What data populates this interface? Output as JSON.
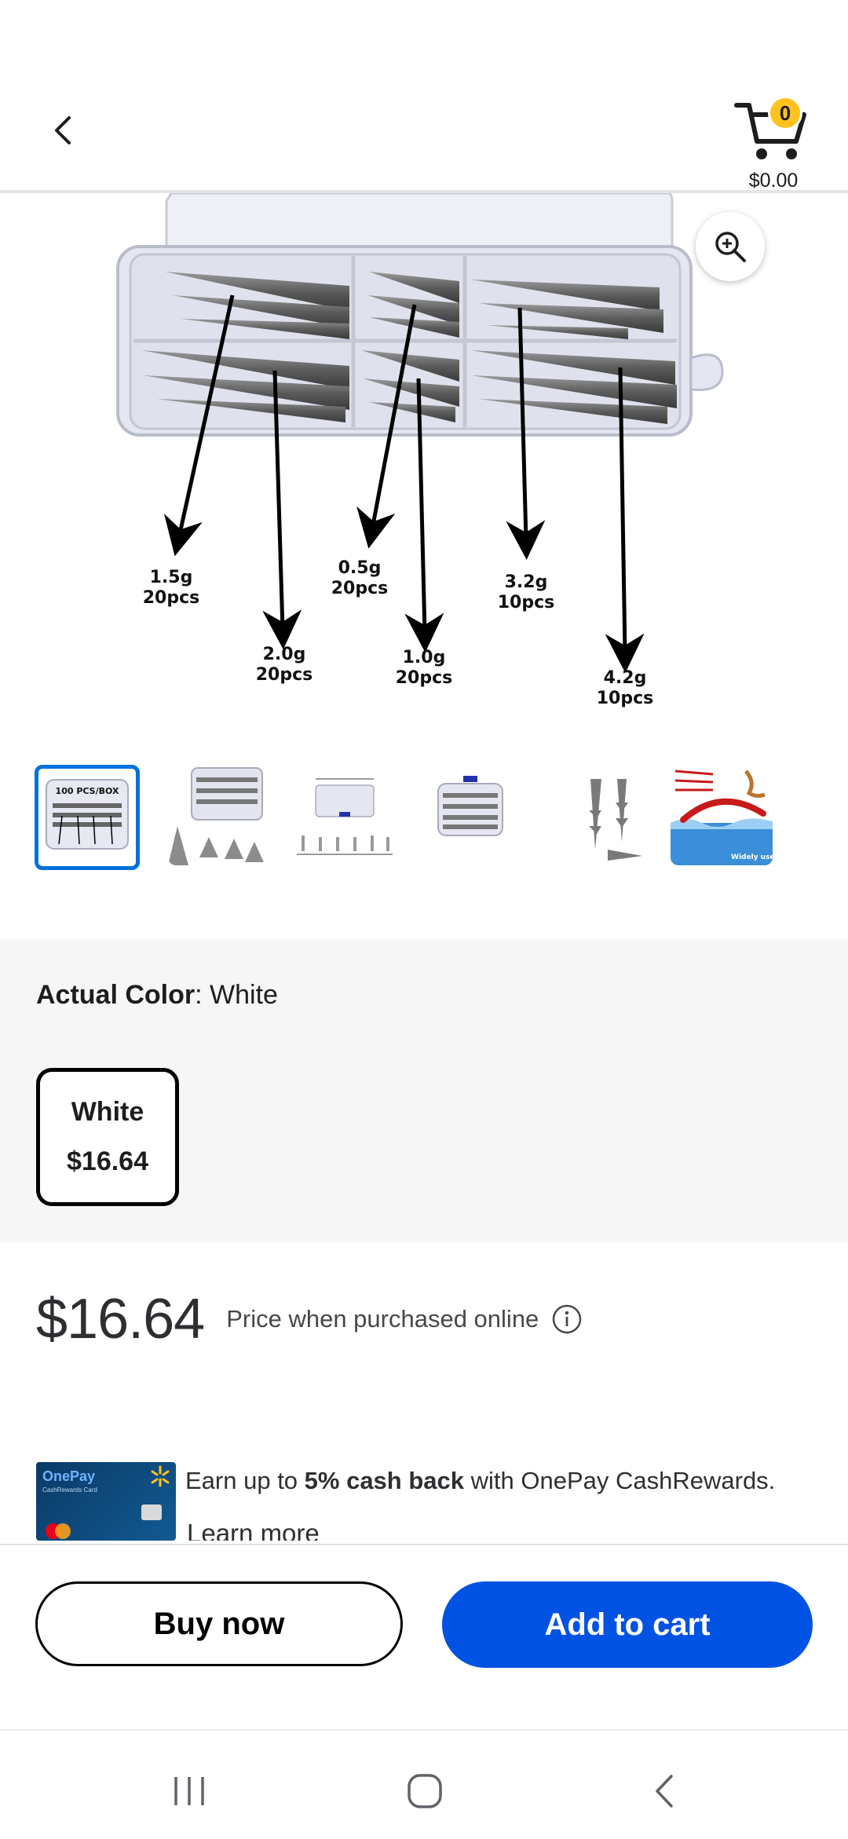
{
  "header": {
    "cart_count": "0",
    "cart_total": "$0.00"
  },
  "product": {
    "image_labels": [
      {
        "weight": "1.5g",
        "count": "20pcs"
      },
      {
        "weight": "2.0g",
        "count": "20pcs"
      },
      {
        "weight": "0.5g",
        "count": "20pcs"
      },
      {
        "weight": "1.0g",
        "count": "20pcs"
      },
      {
        "weight": "3.2g",
        "count": "10pcs"
      },
      {
        "weight": "4.2g",
        "count": "10pcs"
      }
    ],
    "thumbnails": [
      {
        "caption": "100 PCS/BOX"
      },
      {
        "caption": ""
      },
      {
        "caption": ""
      },
      {
        "caption": ""
      },
      {
        "caption": ""
      },
      {
        "caption": "Widely used"
      }
    ],
    "selected_thumbnail_index": 0
  },
  "variant": {
    "label": "Actual Color",
    "separator": ":",
    "value": "White",
    "options": [
      {
        "name": "White",
        "price": "$16.64",
        "selected": true
      }
    ]
  },
  "pricing": {
    "price": "$16.64",
    "note": "Price when purchased online"
  },
  "promo": {
    "card_brand": "OnePay",
    "card_subtitle": "CashRewards Card",
    "text_pre": "Earn up to ",
    "text_bold": "5% cash back",
    "text_post": " with OnePay CashRewards.",
    "link": "Learn more"
  },
  "actions": {
    "buy_now": "Buy now",
    "add_to_cart": "Add to cart"
  },
  "colors": {
    "primary_blue": "#0053e2",
    "selected_border": "#0071dc",
    "badge_yellow": "#ffc220"
  },
  "icons": {
    "back": "chevron-left-icon",
    "cart": "cart-icon",
    "zoom": "zoom-in-icon",
    "info": "info-icon",
    "nav_recent": "recent-apps-icon",
    "nav_home": "home-icon",
    "nav_back": "back-icon"
  }
}
